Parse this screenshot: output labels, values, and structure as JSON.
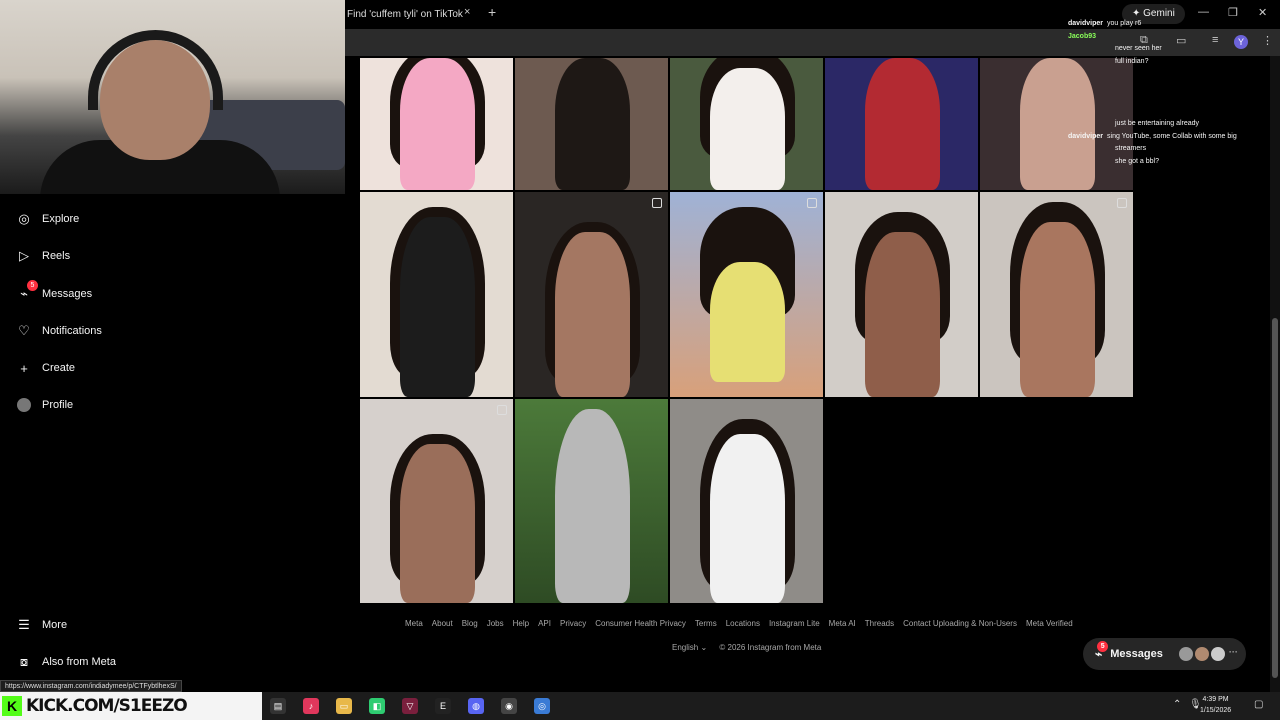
{
  "browser": {
    "active_tab_title": "Find 'cuffem tyli' on TikTok | Tik",
    "close_tab_glyph": "×",
    "new_tab_glyph": "+",
    "gemini_label": "✦ Gemini",
    "avatar_letter": "Y",
    "icons": [
      "minimize-icon",
      "restore-icon",
      "close-icon",
      "extensions-icon",
      "split-screen-icon",
      "media-icon",
      "profile-icon",
      "menu-icon"
    ]
  },
  "sidebar": {
    "items": [
      {
        "label": "Explore",
        "icon": "compass-icon"
      },
      {
        "label": "Reels",
        "icon": "reels-icon"
      },
      {
        "label": "Messages",
        "icon": "messenger-icon",
        "badge": "5"
      },
      {
        "label": "Notifications",
        "icon": "heart-icon"
      },
      {
        "label": "Create",
        "icon": "plus-icon"
      },
      {
        "label": "Profile",
        "icon": "avatar-icon"
      }
    ],
    "more_label": "More",
    "also_from_meta_label": "Also from Meta"
  },
  "footer": {
    "links": [
      "Meta",
      "About",
      "Blog",
      "Jobs",
      "Help",
      "API",
      "Privacy",
      "Consumer Health Privacy",
      "Terms",
      "Locations",
      "Instagram Lite",
      "Meta AI",
      "Threads",
      "Contact Uploading & Non-Users",
      "Meta Verified"
    ],
    "language": "English ⌄",
    "copyright": "© 2026 Instagram from Meta"
  },
  "messages_pill": {
    "label": "Messages",
    "badge": "5"
  },
  "chat": {
    "lines": [
      {
        "user": "davidviper",
        "text": "you play r6",
        "color": "#e6e6e6"
      },
      {
        "user": "Jacob93",
        "text": "",
        "color": "#8aff5a"
      },
      {
        "user": "",
        "text": "never seen her",
        "color": "#e6e6e6"
      },
      {
        "user": "",
        "text": "full indian?",
        "color": "#e6e6e6"
      },
      {
        "user": "",
        "text": "",
        "color": "#e6e6e6"
      },
      {
        "user": "",
        "text": "",
        "color": "#e6e6e6"
      },
      {
        "user": "",
        "text": "",
        "color": "#e6e6e6"
      },
      {
        "user": "",
        "text": "",
        "color": "#e6e6e6"
      },
      {
        "user": "",
        "text": "",
        "color": "#e6e6e6"
      },
      {
        "user": "",
        "text": "just be entertaining already",
        "color": "#e6e6e6"
      },
      {
        "user": "davidviper",
        "text": "sing YouTube, some Collab with some big",
        "color": "#e6e6e6"
      },
      {
        "user": "",
        "text": "streamers",
        "color": "#e6e6e6"
      },
      {
        "user": "",
        "text": "she got a bbl?",
        "color": "#e6e6e6"
      }
    ]
  },
  "status_url": "https://www.instagram.com/indiadymee/p/CTFybtlhexS/",
  "taskbar": {
    "kick_label": "KICK.COM/S1EEZO",
    "kick_logo": "K",
    "time": "4:39 PM",
    "date": "1/15/2026"
  },
  "colors": {
    "background": "#000000",
    "badge": "#ff3040",
    "kick_green": "#53fc18",
    "footer_text": "#a8a8a8"
  }
}
